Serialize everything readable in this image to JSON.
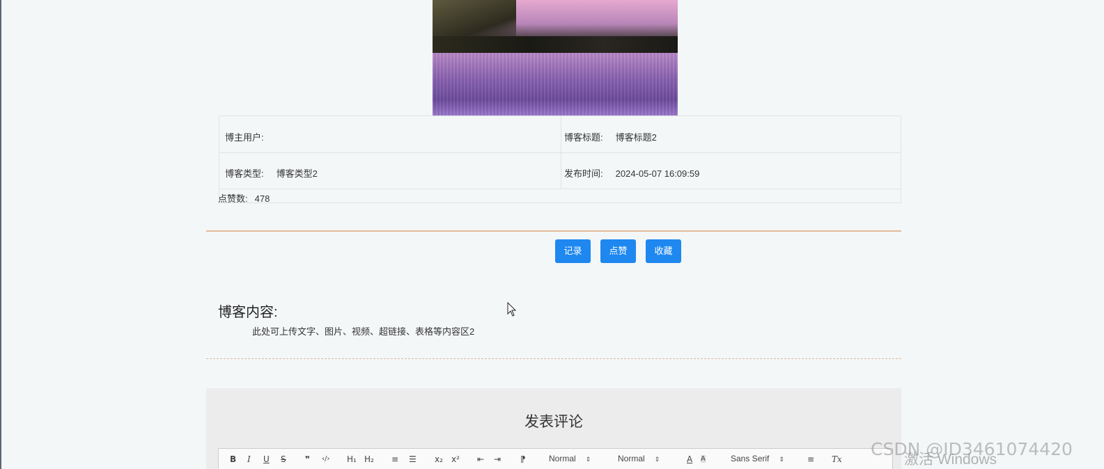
{
  "blog": {
    "author_label": "博主用户:",
    "author_value": "",
    "title_label": "博客标题:",
    "title_value": "博客标题2",
    "type_label": "博客类型:",
    "type_value": "博客类型2",
    "time_label": "发布时间:",
    "time_value": "2024-05-07 16:09:59",
    "likes_label": "点赞数:",
    "likes_value": "478"
  },
  "actions": {
    "record": "记录",
    "like": "点赞",
    "favorite": "收藏"
  },
  "content": {
    "heading": "博客内容:",
    "body": "此处可上传文字、图片、视频、超链接、表格等内容区2"
  },
  "comment": {
    "heading": "发表评论",
    "toolbar": {
      "bold": "B",
      "italic": "I",
      "underline": "U",
      "strike": "S",
      "blockquote": "❞",
      "code": "‹/›",
      "h1": "H₁",
      "h2": "H₂",
      "ordered_list": "≡",
      "bullet_list": "☰",
      "subscript": "x₂",
      "superscript": "x²",
      "outdent": "⇤",
      "indent": "⇥",
      "direction": "⁋",
      "size_select": "Normal",
      "header_select": "Normal",
      "color": "A",
      "background": "A",
      "font_select": "Sans Serif",
      "align": "≡",
      "clean": "Tx"
    }
  },
  "overlay": {
    "watermark": "CSDN @ID3461074420",
    "activate": "激活 Windows"
  }
}
